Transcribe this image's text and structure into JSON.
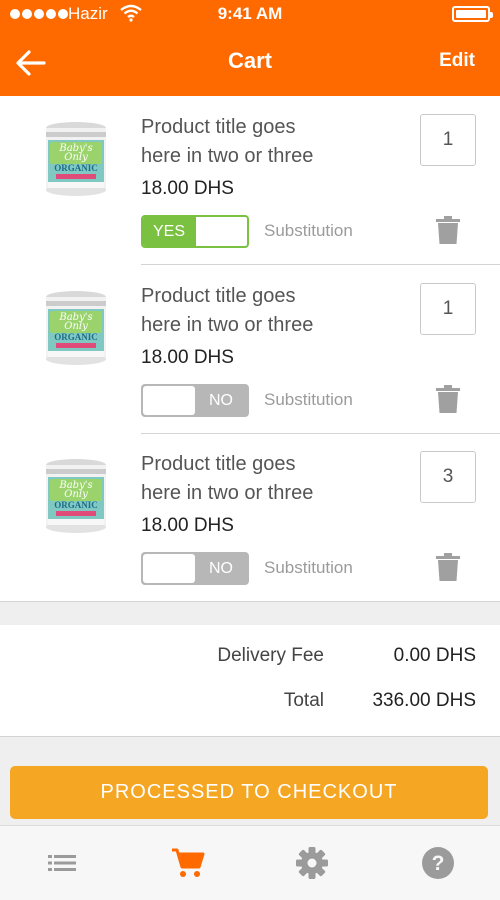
{
  "status_bar": {
    "carrier": "Hazir",
    "time": "9:41 AM"
  },
  "header": {
    "title": "Cart",
    "edit_label": "Edit"
  },
  "items": [
    {
      "title_line1": "Product title goes",
      "title_line2": "here in two or three",
      "price": "18.00 DHS",
      "quantity": "1",
      "substitution_toggle": "YES",
      "substitution_on": true,
      "substitution_label": "Substitution"
    },
    {
      "title_line1": "Product title goes",
      "title_line2": "here in two or three",
      "price": "18.00 DHS",
      "quantity": "1",
      "substitution_toggle": "NO",
      "substitution_on": false,
      "substitution_label": "Substitution"
    },
    {
      "title_line1": "Product title goes",
      "title_line2": "here in two or three",
      "price": "18.00 DHS",
      "quantity": "3",
      "substitution_toggle": "NO",
      "substitution_on": false,
      "substitution_label": "Substitution"
    }
  ],
  "summary": {
    "delivery_label": "Delivery Fee",
    "delivery_value": "0.00 DHS",
    "total_label": "Total",
    "total_value": "336.00 DHS"
  },
  "checkout_label": "PROCESSED TO CHECKOUT",
  "product_image": {
    "line1": "Baby's",
    "line2": "Only",
    "line3": "ORGANIC"
  },
  "tabs": [
    "list-icon",
    "cart-icon",
    "gear-icon",
    "help-icon"
  ],
  "colors": {
    "brand": "#ff6a00",
    "toggle_on": "#7ac142",
    "checkout": "#f5a623",
    "icon_gray": "#9b9b9b"
  }
}
